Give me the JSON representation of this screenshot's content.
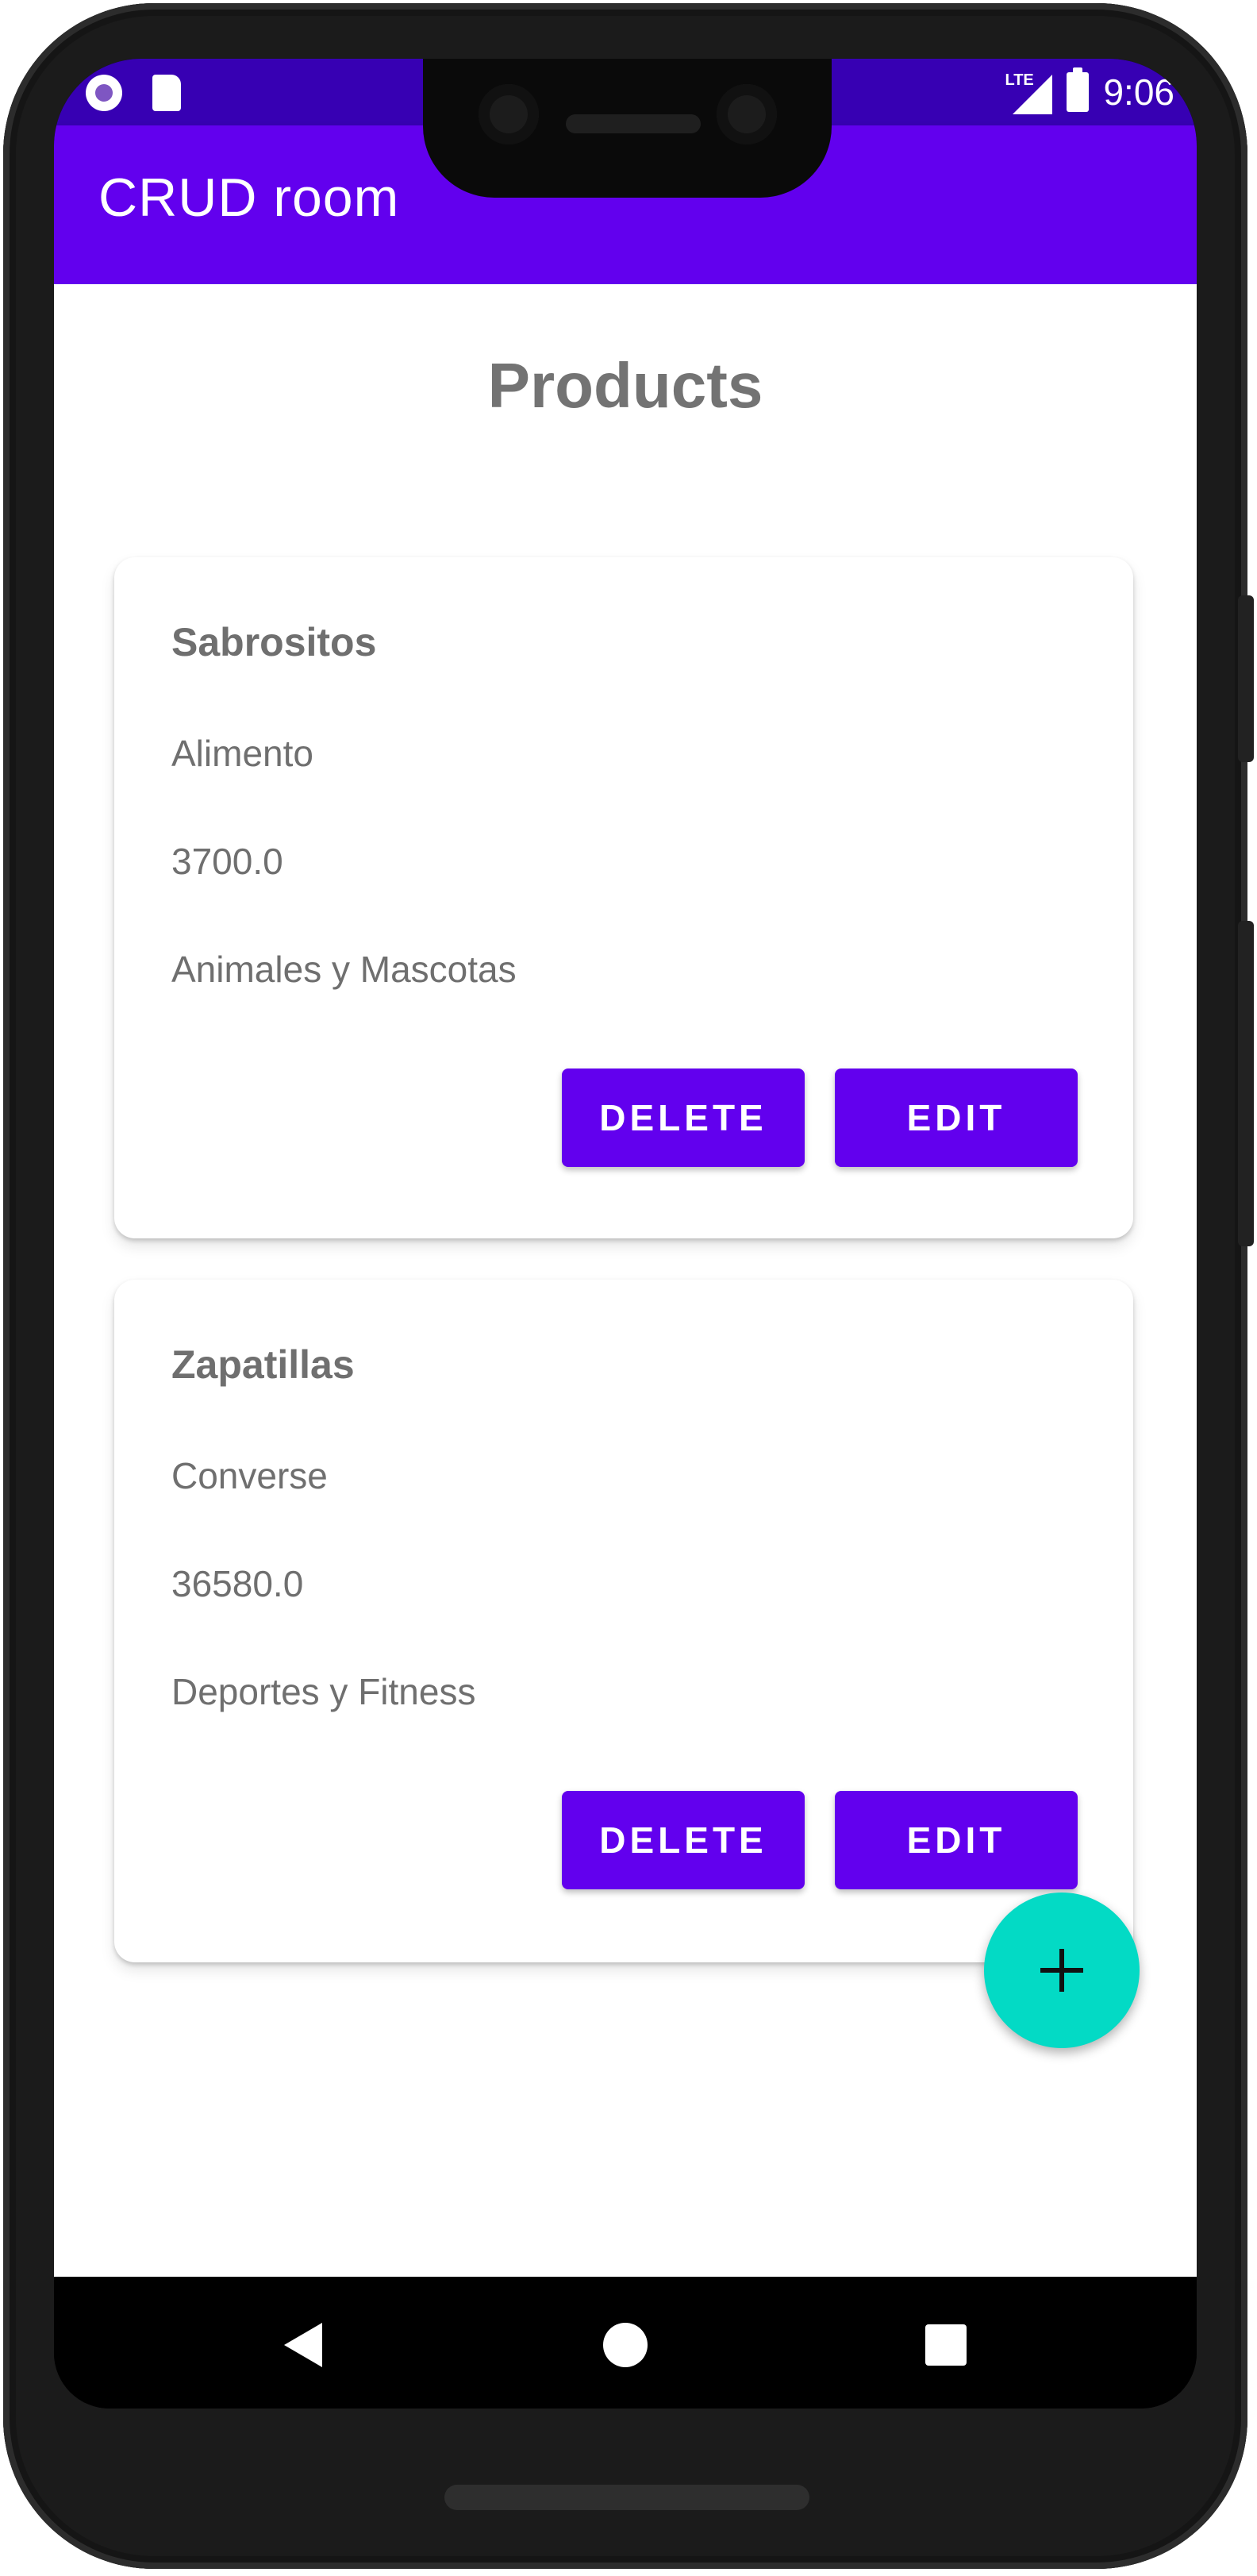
{
  "status_bar": {
    "left_icons": [
      "recording-icon",
      "sd-card-icon"
    ],
    "network": "LTE",
    "time": "9:06"
  },
  "app_bar": {
    "title": "CRUD room"
  },
  "page": {
    "title": "Products"
  },
  "products": [
    {
      "name": "Sabrositos",
      "brand": "Alimento",
      "price": "3700.0",
      "category": "Animales y Mascotas",
      "delete_label": "DELETE",
      "edit_label": "EDIT"
    },
    {
      "name": "Zapatillas",
      "brand": "Converse",
      "price": "36580.0",
      "category": "Deportes y Fitness",
      "delete_label": "DELETE",
      "edit_label": "EDIT"
    }
  ],
  "fab": {
    "icon": "plus-icon"
  },
  "nav_bar": {
    "icons": [
      "back-icon",
      "home-icon",
      "recents-icon"
    ]
  },
  "colors": {
    "primary": "#6200ee",
    "primary_dark": "#3700b3",
    "accent": "#03dac5",
    "text_gray": "#6f6f6f"
  }
}
